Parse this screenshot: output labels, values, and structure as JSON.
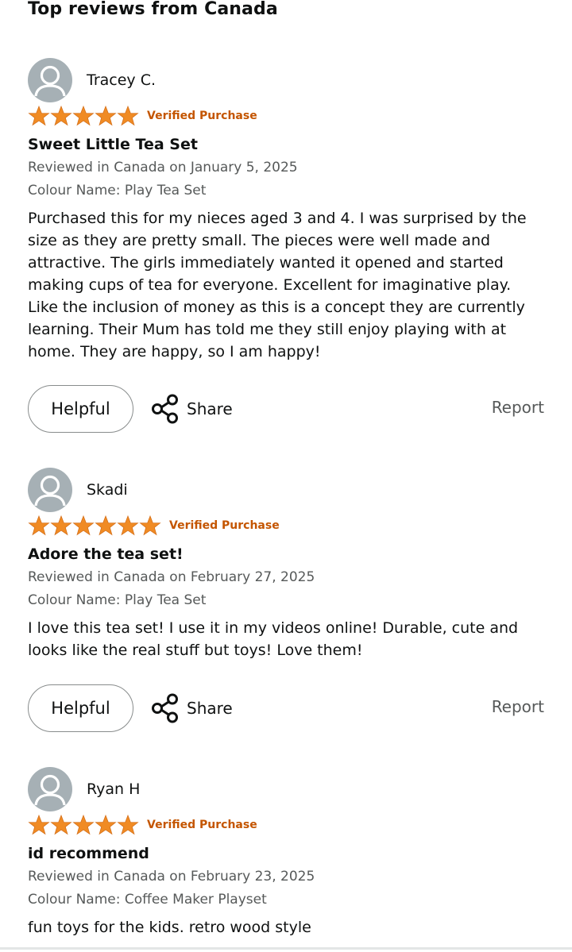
{
  "header": {
    "title": "Top reviews from Canada"
  },
  "colors": {
    "star": "#f08b24",
    "verified": "#c45500",
    "muted_text": "#565959",
    "avatar_bg": "#a6b0b5"
  },
  "icons": {
    "avatar": "person-silhouette-icon",
    "star": "star-icon",
    "share": "share-icon"
  },
  "reviews": [
    {
      "reviewer": "Tracey C.",
      "rating": 5,
      "rating_max": 5,
      "verified_label": "Verified Purchase",
      "title": "Sweet Little Tea Set",
      "date": "Reviewed in Canada on January 5, 2025",
      "variant": "Colour Name: Play Tea Set",
      "body": "Purchased this for my nieces aged 3 and 4. I was surprised by the size as they are pretty small. The pieces were well made and attractive. The girls immediately wanted it opened and started making cups of tea for everyone. Excellent for imaginative play. Like the inclusion of money as this is a concept they are currently learning. Their Mum has told me they still enjoy playing with at home. They are happy, so I am happy!",
      "helpful_label": "Helpful",
      "share_label": "Share",
      "report_label": "Report"
    },
    {
      "reviewer": "Skadi",
      "rating": 5,
      "rating_max": 5,
      "verified_label": "Verified Purchase",
      "title": "Adore the tea set!",
      "date": "Reviewed in Canada on February 27, 2025",
      "variant": "Colour Name: Play Tea Set",
      "body": "I love this tea set! I use it in my videos online! Durable, cute and looks like the real stuff but toys! Love them!",
      "helpful_label": "Helpful",
      "share_label": "Share",
      "report_label": "Report"
    },
    {
      "reviewer": "Ryan H",
      "rating": 5,
      "rating_max": 5,
      "verified_label": "Verified Purchase",
      "title": "id recommend",
      "date": "Reviewed in Canada on February 23, 2025",
      "variant": "Colour Name: Coffee Maker Playset",
      "body": "fun toys for the kids. retro wood style"
    }
  ]
}
